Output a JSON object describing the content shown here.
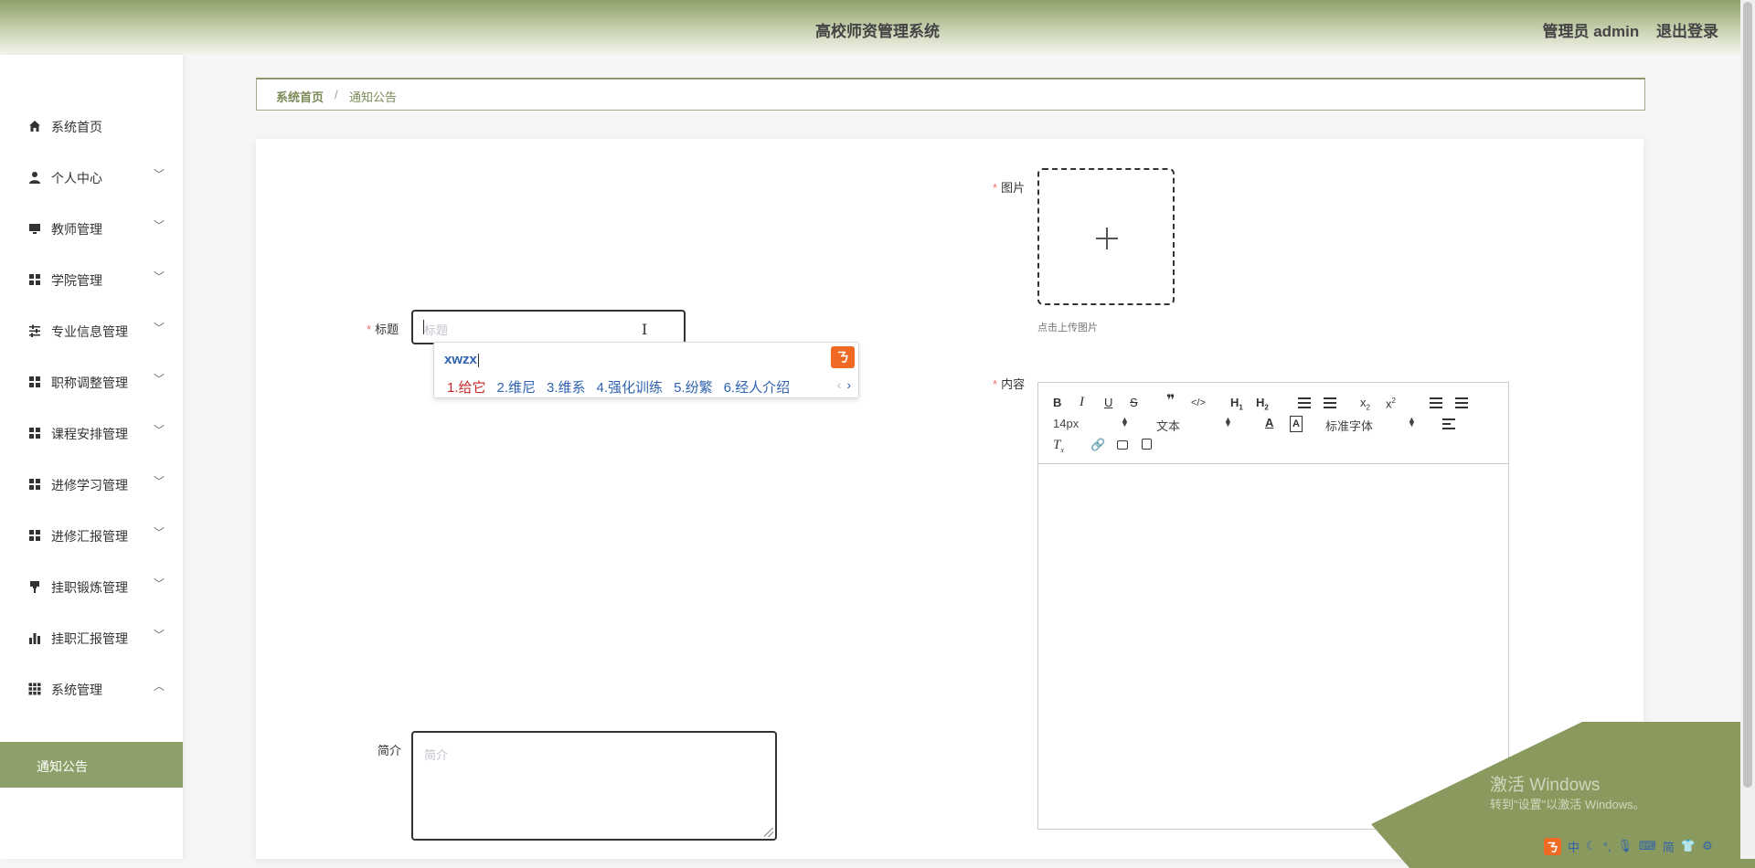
{
  "header": {
    "title": "高校师资管理系统",
    "user": "管理员 admin",
    "logout": "退出登录"
  },
  "sidebar": {
    "items": [
      {
        "label": "系统首页",
        "icon": "home-icon"
      },
      {
        "label": "个人中心",
        "icon": "user-icon"
      },
      {
        "label": "教师管理",
        "icon": "monitor-icon"
      },
      {
        "label": "学院管理",
        "icon": "grid-icon"
      },
      {
        "label": "专业信息管理",
        "icon": "sliders-icon"
      },
      {
        "label": "职称调整管理",
        "icon": "grid-icon"
      },
      {
        "label": "课程安排管理",
        "icon": "grid-icon"
      },
      {
        "label": "进修学习管理",
        "icon": "grid-icon"
      },
      {
        "label": "进修汇报管理",
        "icon": "grid-icon"
      },
      {
        "label": "挂职锻炼管理",
        "icon": "brush-icon"
      },
      {
        "label": "挂职汇报管理",
        "icon": "bar-chart-icon"
      },
      {
        "label": "系统管理",
        "icon": "apps-icon"
      }
    ],
    "active_sub": "通知公告"
  },
  "breadcrumb": {
    "home": "系统首页",
    "separator": "/",
    "current": "通知公告"
  },
  "form": {
    "title_label": "标题",
    "title_placeholder": "标题",
    "image_label": "图片",
    "upload_hint": "点击上传图片",
    "content_label": "内容",
    "intro_label": "简介",
    "intro_placeholder": "简介"
  },
  "ime": {
    "pinyin": "xwzx",
    "candidates": [
      "1.给它",
      "2.维尼",
      "3.维系",
      "4.强化训练",
      "5.纷繁",
      "6.经人介绍"
    ]
  },
  "editor": {
    "font_size": "14px",
    "paragraph": "文本",
    "font_family": "标准字体"
  },
  "watermark": {
    "line1": "激活 Windows",
    "line2": "转到\"设置\"以激活 Windows。"
  },
  "tray": {
    "items": [
      "中",
      "简"
    ]
  },
  "colors": {
    "accent": "#8ea06a",
    "required": "#f56c6c"
  }
}
